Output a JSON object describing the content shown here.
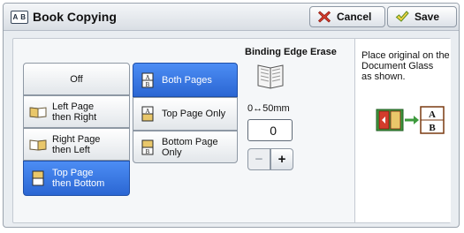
{
  "header": {
    "title": "Book Copying",
    "title_icon_text": "A B",
    "cancel_label": "Cancel",
    "save_label": "Save"
  },
  "layout_options": {
    "items": [
      {
        "label": "Off",
        "icon": "none",
        "selected": false
      },
      {
        "label": "Left Page\nthen Right",
        "icon": "open-book-icon",
        "selected": false
      },
      {
        "label": "Right Page\nthen Left",
        "icon": "open-book-icon",
        "selected": false
      },
      {
        "label": "Top Page\nthen Bottom",
        "icon": "flip-book-icon",
        "selected": true
      }
    ]
  },
  "page_options": {
    "items": [
      {
        "label": "Both Pages",
        "icon": "both-pages-icon",
        "selected": true
      },
      {
        "label": "Top Page Only",
        "icon": "top-page-icon",
        "selected": false
      },
      {
        "label": "Bottom Page\nOnly",
        "icon": "bottom-page-icon",
        "selected": false
      }
    ]
  },
  "binding_edge_erase": {
    "label": "Binding Edge Erase",
    "range": "0↔50mm",
    "value": "0",
    "minus": "−",
    "plus": "+"
  },
  "info": {
    "text": "Place original on the\nDocument Glass\nas shown.",
    "glass_letters": [
      "A",
      "B"
    ]
  },
  "colors": {
    "selected": "#2b66d3",
    "accent_red": "#d43c2c",
    "accent_green": "#3d9a3d"
  }
}
